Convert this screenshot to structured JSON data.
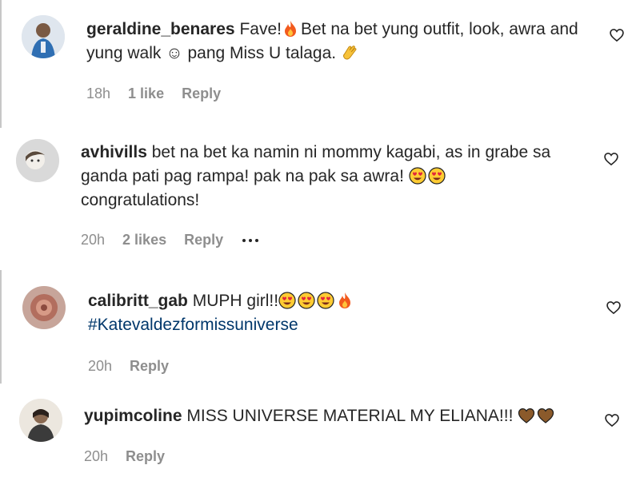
{
  "comments": [
    {
      "username": "geraldine_benares",
      "text_1": "Fave!",
      "text_2": "Bet na bet yung outfit, look, awra and yung walk ☺ pang Miss U talaga.",
      "time": "18h",
      "likes": "1 like",
      "reply": "Reply",
      "avatar_icon": "avatar-photo-geraldine",
      "icons": [
        "fire-icon",
        "clapping-hands-icon"
      ]
    },
    {
      "username": "avhivills",
      "text_1": "bet na bet ka namin ni mommy kagabi, as in grabe sa ganda pati pag rampa! pak na pak sa awra!",
      "text_2": "congratulations!",
      "time": "20h",
      "likes": "2 likes",
      "reply": "Reply",
      "avatar_icon": "avatar-photo-avhivills",
      "icons": [
        "heart-eyes-icon",
        "heart-eyes-icon"
      ]
    },
    {
      "username": "calibritt_gab",
      "text_1": "MUPH girl!!",
      "hashtag": "#Katevaldezformissuniverse",
      "time": "20h",
      "reply": "Reply",
      "avatar_icon": "avatar-photo-calibritt",
      "icons": [
        "heart-eyes-icon",
        "heart-eyes-icon",
        "heart-eyes-icon",
        "fire-icon"
      ]
    },
    {
      "username": "yupimcoline",
      "text_1": "MISS UNIVERSE MATERIAL MY ELIANA!!!",
      "time": "20h",
      "reply": "Reply",
      "avatar_icon": "avatar-photo-yupimcoline",
      "icons": [
        "brown-heart-icon",
        "brown-heart-icon"
      ]
    }
  ],
  "like_icon": "heart-outline-icon",
  "more_icon": "more-options-icon",
  "colors": {
    "text": "#262626",
    "meta": "#8e8e8e",
    "hashtag": "#00376b",
    "thread_line": "#c7c7c7"
  }
}
